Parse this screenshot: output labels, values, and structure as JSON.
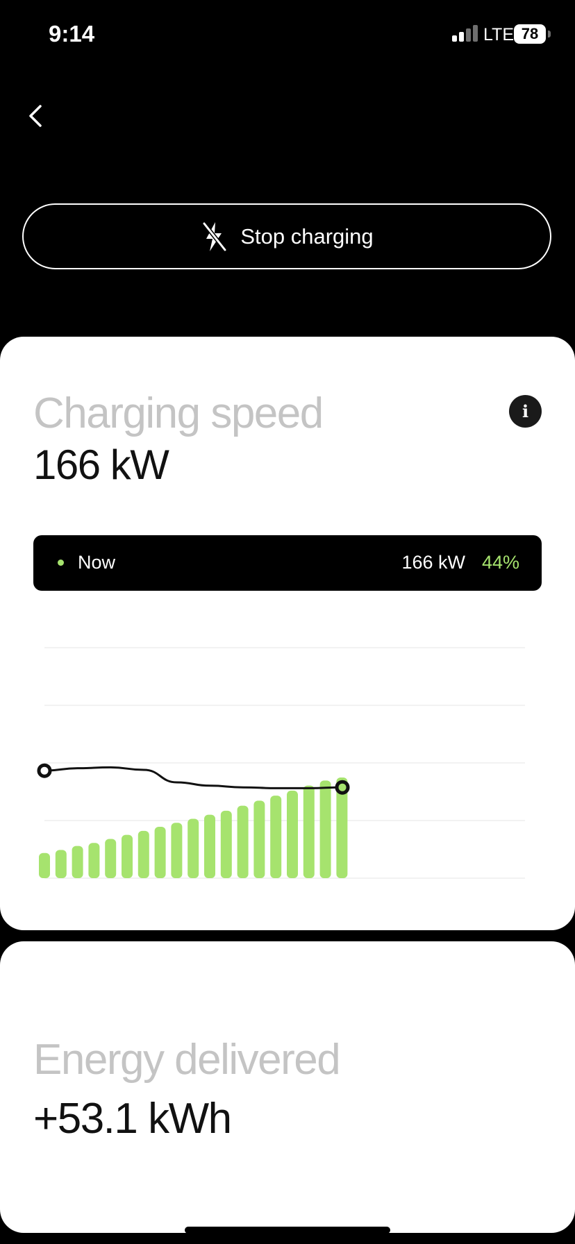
{
  "status_bar": {
    "time": "9:14",
    "network": "LTE",
    "battery": "78",
    "signal_bars_active": 2,
    "signal_bars_total": 4
  },
  "nav": {
    "back_icon": "chevron-left-icon"
  },
  "stop_button": {
    "label": "Stop charging",
    "icon": "bolt-slash-icon"
  },
  "speed_card": {
    "title": "Charging speed",
    "value": "166 kW",
    "info_icon": "i",
    "now_bar": {
      "label": "Now",
      "power": "166 kW",
      "percent": "44%"
    }
  },
  "energy_card": {
    "title": "Energy delivered",
    "value": "+53.1 kWh"
  },
  "colors": {
    "accent_green": "#a6e36e",
    "background": "#000000",
    "card": "#ffffff",
    "title_gray": "#c4c4c4"
  },
  "chart_data": {
    "type": "bar",
    "values": [
      0.25,
      0.28,
      0.32,
      0.35,
      0.39,
      0.43,
      0.47,
      0.51,
      0.55,
      0.59,
      0.63,
      0.67,
      0.72,
      0.77,
      0.82,
      0.87,
      0.92,
      0.97,
      1.0
    ],
    "line": [
      0.79,
      0.82,
      0.83,
      0.8,
      0.65,
      0.61,
      0.59,
      0.58,
      0.58,
      0.59
    ]
  }
}
